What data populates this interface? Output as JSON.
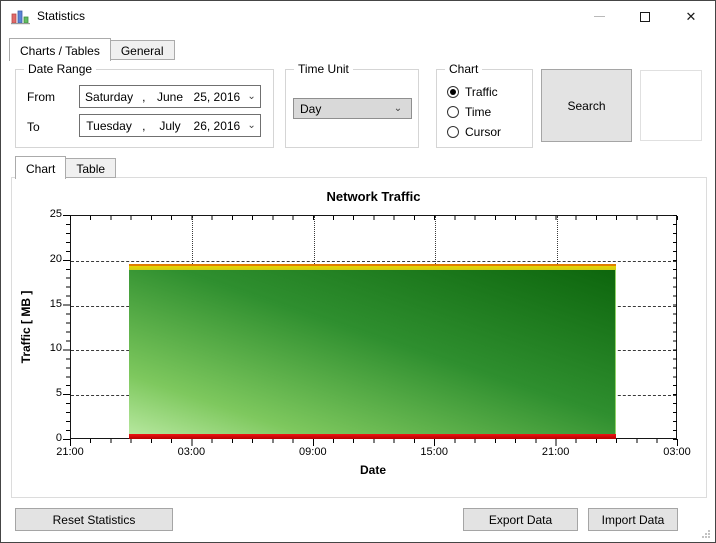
{
  "window": {
    "title": "Statistics",
    "controls": {
      "minimize": "minimize",
      "maximize": "maximize",
      "close_glyph": "✕"
    }
  },
  "main_tabs": [
    {
      "label": "Charts / Tables",
      "active": true
    },
    {
      "label": "General",
      "active": false
    }
  ],
  "filters": {
    "date_range": {
      "legend": "Date Range",
      "from_label": "From",
      "to_label": "To",
      "from": {
        "weekday": "Saturday",
        "sep": ",",
        "month": "June",
        "day_year": "25, 2016",
        "chevron": "⌄"
      },
      "to": {
        "weekday": "Tuesday",
        "sep": ",",
        "month": "July",
        "day_year": "26, 2016",
        "chevron": "⌄"
      }
    },
    "time_unit": {
      "legend": "Time Unit",
      "selected": "Day",
      "chevron": "⌄"
    },
    "chart_options": {
      "legend": "Chart",
      "options": [
        {
          "label": "Traffic",
          "selected": true
        },
        {
          "label": "Time",
          "selected": false
        },
        {
          "label": "Cursor",
          "selected": false
        }
      ]
    },
    "search_label": "Search"
  },
  "view_tabs": [
    {
      "label": "Chart",
      "active": true
    },
    {
      "label": "Table",
      "active": false
    }
  ],
  "chart_data": {
    "type": "area",
    "title": "Network Traffic",
    "xlabel": "Date",
    "ylabel": "Traffic [ MB ]",
    "ylim": [
      0,
      25
    ],
    "grid": true,
    "x_tick_labels": [
      "21:00",
      "03:00",
      "09:00",
      "15:00",
      "21:00",
      "03:00"
    ],
    "y_tick_labels": [
      "25",
      "20",
      "15",
      "10",
      "5",
      "0"
    ],
    "data_span": {
      "start": "00:00",
      "end": "24:00"
    },
    "series": [
      {
        "name": "traffic-fill",
        "style": "gradient-area",
        "color_top_right": "#0d660d",
        "color_bottom_left": "#b6e79e",
        "value_top": 19.0,
        "value_bottom": 0.5
      },
      {
        "name": "upper-band",
        "style": "band",
        "color": "#d9d000",
        "value_from": 19.0,
        "value_to": 19.4
      },
      {
        "name": "upper-edge-line",
        "style": "line",
        "color": "#e07d00",
        "value": 19.5
      },
      {
        "name": "lower-band",
        "style": "band",
        "color": "#dd1111",
        "value_from": 0.0,
        "value_to": 0.5
      }
    ]
  },
  "footer": {
    "reset": "Reset Statistics",
    "export": "Export Data",
    "import": "Import Data"
  }
}
